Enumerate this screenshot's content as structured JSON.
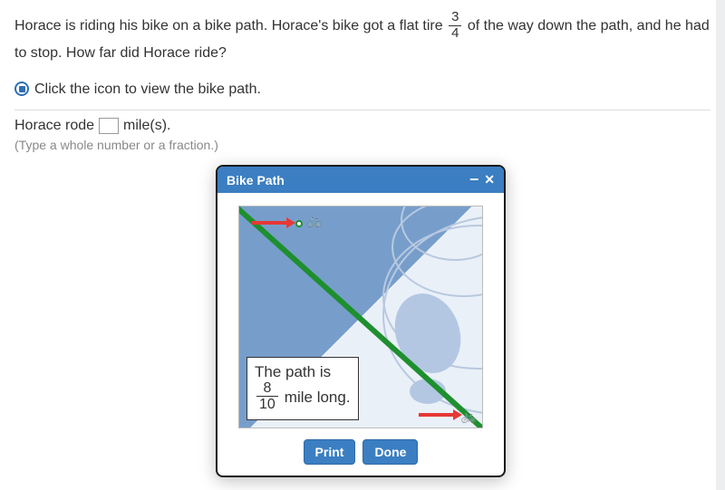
{
  "question": {
    "part1": "Horace is riding his bike on a bike path. Horace's bike got a flat tire ",
    "fraction": {
      "num": "3",
      "den": "4"
    },
    "part2": " of the way down the path, and he had to stop. How far did Horace ride?",
    "icon_prompt": "Click the icon to view the bike path."
  },
  "answer": {
    "prefix": "Horace rode",
    "value": "",
    "suffix": "mile(s).",
    "hint": "(Type a whole number or a fraction.)"
  },
  "popup": {
    "title": "Bike Path",
    "callout_line1": "The path is",
    "callout_fraction": {
      "num": "8",
      "den": "10"
    },
    "callout_suffix": "mile long.",
    "print_label": "Print",
    "done_label": "Done"
  },
  "chart_data": {
    "type": "diagram",
    "description": "Map showing a diagonal green bike path running from upper-left to lower-right across a shoreline. Red arrows indicate direction of travel. Bicycle icons mark start (top-left) and end (bottom-right).",
    "path_length_miles": {
      "numerator": 8,
      "denominator": 10
    },
    "flat_tire_fraction_of_path": {
      "numerator": 3,
      "denominator": 4
    }
  }
}
